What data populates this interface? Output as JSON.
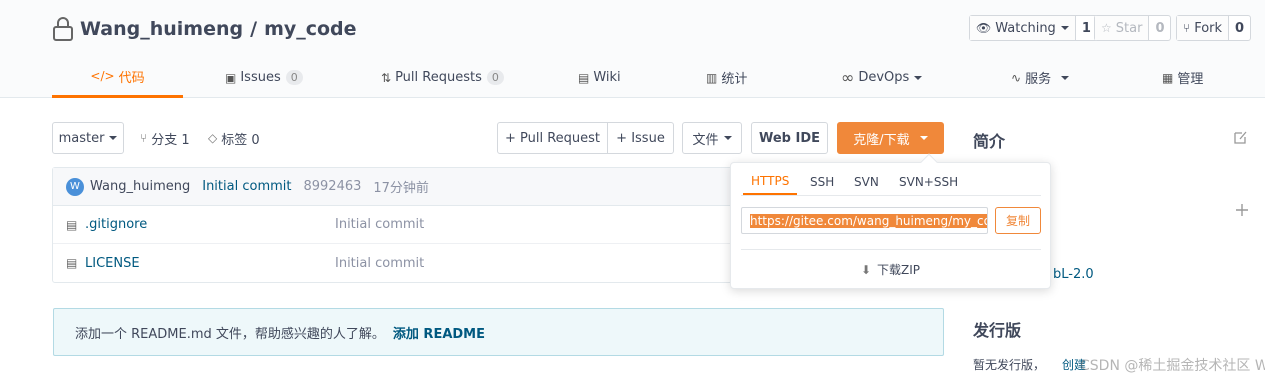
{
  "repo": {
    "owner": "Wang_huimeng",
    "separator": "/",
    "name": "my_code"
  },
  "actions": {
    "watch": {
      "label": "Watching",
      "count": "1"
    },
    "star": {
      "label": "Star",
      "count": "0"
    },
    "fork": {
      "label": "Fork",
      "count": "0"
    }
  },
  "tabs": [
    {
      "label": "代码",
      "icon": "code-icon"
    },
    {
      "label": "Issues",
      "badge": "0",
      "icon": "issues-icon"
    },
    {
      "label": "Pull Requests",
      "badge": "0",
      "icon": "pull-request-icon"
    },
    {
      "label": "Wiki",
      "icon": "book-icon"
    },
    {
      "label": "统计",
      "icon": "chart-icon"
    },
    {
      "label": "DevOps",
      "icon": "infinity-icon"
    },
    {
      "label": "服务",
      "icon": "pulse-icon"
    },
    {
      "label": "管理",
      "icon": "settings-doc-icon"
    }
  ],
  "toolbar": {
    "branch": "master",
    "branches": "分支 1",
    "tags": "标签 0",
    "pull_request": "+ Pull Request",
    "issue": "+ Issue",
    "file": "文件",
    "web_ide": "Web IDE",
    "clone": "克隆/下载"
  },
  "commit": {
    "author": "Wang_huimeng",
    "avatar": "W",
    "message": "Initial commit",
    "hash": "8992463",
    "time": "17分钟前"
  },
  "files": [
    {
      "name": ".gitignore",
      "message": "Initial commit"
    },
    {
      "name": "LICENSE",
      "message": "Initial commit"
    }
  ],
  "readme": {
    "text": "添加一个 README.md 文件，帮助感兴趣的人了解。",
    "link": "添加 README"
  },
  "clone_dropdown": {
    "protocols": [
      "HTTPS",
      "SSH",
      "SVN",
      "SVN+SSH"
    ],
    "url": "https://gitee.com/wang_huimeng/my_code.git",
    "copy": "复制",
    "download_zip": "下载ZIP"
  },
  "sidebar": {
    "intro_title": "简介",
    "license_fragment": "bL-2.0",
    "releases_title": "发行版",
    "no_release": "暂无发行版，",
    "create": "创建"
  },
  "watermark": "CSDN @稀土掘金技术社区 Wang",
  "colors": {
    "accent": "#fe7300",
    "button_orange": "#f0883a",
    "link": "#005980"
  }
}
